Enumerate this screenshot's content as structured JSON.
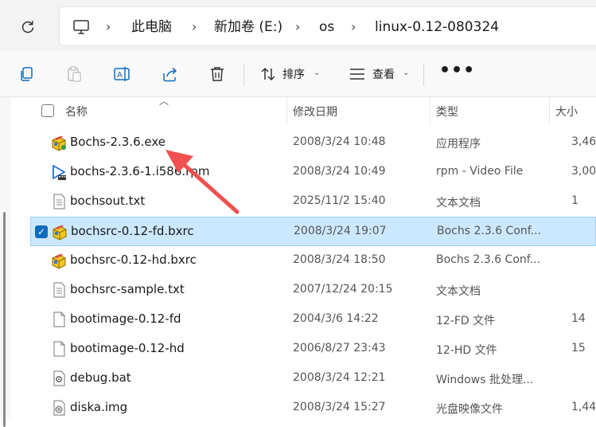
{
  "address": {
    "crumbs": [
      "此电脑",
      "新加卷 (E:)",
      "os",
      "linux-0.12-080324"
    ]
  },
  "toolbar": {
    "sort_label": "排序",
    "view_label": "查看",
    "more_label": "•••"
  },
  "columns": {
    "name": "名称",
    "modified": "修改日期",
    "type": "类型",
    "size": "大小"
  },
  "files": [
    {
      "name": "Bochs-2.3.6.exe",
      "modified": "2008/3/24 10:48",
      "type": "应用程序",
      "size": "3,46",
      "icon": "installer-icon"
    },
    {
      "name": "bochs-2.3.6-1.i586.rpm",
      "modified": "2008/3/24 10:49",
      "type": "rpm - Video File",
      "size": "3,00",
      "icon": "video-file-icon"
    },
    {
      "name": "bochsout.txt",
      "modified": "2025/11/2 15:40",
      "type": "文本文档",
      "size": "1",
      "icon": "text-file-icon"
    },
    {
      "name": "bochsrc-0.12-fd.bxrc",
      "modified": "2008/3/24 19:07",
      "type": "Bochs 2.3.6 Conf...",
      "size": "",
      "icon": "bochs-config-icon",
      "selected": true
    },
    {
      "name": "bochsrc-0.12-hd.bxrc",
      "modified": "2008/3/24 18:50",
      "type": "Bochs 2.3.6 Conf...",
      "size": "",
      "icon": "bochs-config-icon"
    },
    {
      "name": "bochsrc-sample.txt",
      "modified": "2007/12/24 20:15",
      "type": "文本文档",
      "size": "",
      "icon": "text-file-icon"
    },
    {
      "name": "bootimage-0.12-fd",
      "modified": "2004/3/6 14:22",
      "type": "12-FD 文件",
      "size": "14",
      "icon": "blank-file-icon"
    },
    {
      "name": "bootimage-0.12-hd",
      "modified": "2006/8/27 23:43",
      "type": "12-HD 文件",
      "size": "15",
      "icon": "blank-file-icon"
    },
    {
      "name": "debug.bat",
      "modified": "2008/3/24 12:21",
      "type": "Windows 批处理...",
      "size": "",
      "icon": "batch-file-icon"
    },
    {
      "name": "diska.img",
      "modified": "2008/3/24 15:27",
      "type": "光盘映像文件",
      "size": "1,44",
      "icon": "disc-image-icon"
    }
  ],
  "colors": {
    "selection_bg": "#cce8ff",
    "selection_border": "#99d1ff",
    "accent": "#0f6cbd",
    "annotation_arrow": "#f0504f"
  }
}
